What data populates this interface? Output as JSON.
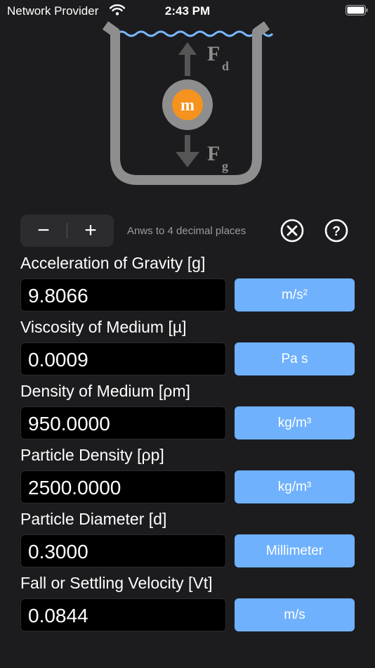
{
  "status_bar": {
    "carrier": "Network Provider",
    "time": "2:43 PM",
    "icons": [
      "wifi-icon",
      "battery-icon"
    ]
  },
  "diagram": {
    "mass_label": "m",
    "force_up": "F",
    "force_up_sub": "d",
    "force_down": "F",
    "force_down_sub": "g",
    "colors": {
      "container": "#8e8e8e",
      "water": "#7ab8ff",
      "mass": "#f6921e",
      "arrow": "#555555"
    }
  },
  "toolbar": {
    "minus_label": "−",
    "plus_label": "+",
    "hint": "Anws to 4 decimal places",
    "icons": [
      "clear-icon",
      "help-icon"
    ]
  },
  "fields": [
    {
      "label": "Acceleration of Gravity [g]",
      "value": "9.8066",
      "unit": "m/s²"
    },
    {
      "label": "Viscosity of Medium [µ]",
      "value": "0.0009",
      "unit": "Pa s"
    },
    {
      "label": "Density of Medium [ρm]",
      "value": "950.0000",
      "unit": "kg/m³"
    },
    {
      "label": "Particle Density [ρp]",
      "value": "2500.0000",
      "unit": "kg/m³"
    },
    {
      "label": "Particle Diameter [d]",
      "value": "0.3000",
      "unit": "Millimeter"
    },
    {
      "label": "Fall or Settling Velocity [Vt]",
      "value": "0.0844",
      "unit": "m/s"
    }
  ],
  "theme": {
    "background": "#1c1c1e",
    "accent": "#6fb1fc"
  }
}
